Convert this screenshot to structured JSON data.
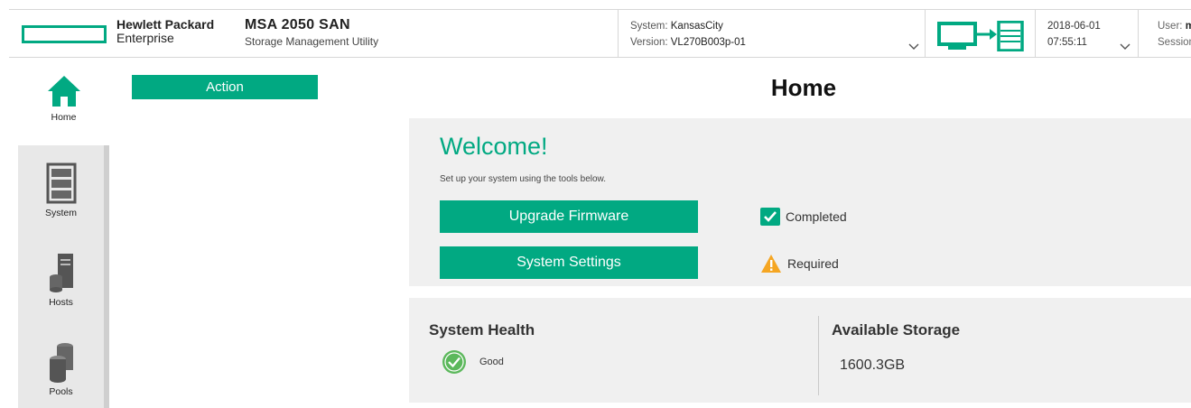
{
  "header": {
    "brand_line1": "Hewlett Packard",
    "brand_line2": "Enterprise",
    "product_name": "MSA 2050 SAN",
    "product_sub": "Storage Management Utility",
    "system_label": "System:",
    "system_value": "KansasCity",
    "version_label": "Version:",
    "version_value": "VL270B003p-01",
    "date": "2018-06-01",
    "time": "07:55:11",
    "user_label": "User:",
    "user_value": "m",
    "session_label": "Session"
  },
  "sidebar": {
    "items": [
      {
        "label": "Home",
        "icon": "home-icon"
      },
      {
        "label": "System",
        "icon": "system-icon"
      },
      {
        "label": "Hosts",
        "icon": "hosts-icon"
      },
      {
        "label": "Pools",
        "icon": "pools-icon"
      }
    ]
  },
  "action_label": "Action",
  "page_title": "Home",
  "welcome": {
    "title": "Welcome!",
    "subtitle": "Set up your system using the tools below.",
    "upgrade_label": "Upgrade Firmware",
    "upgrade_status": "Completed",
    "settings_label": "System Settings",
    "settings_status": "Required"
  },
  "health": {
    "title": "System Health",
    "status": "Good"
  },
  "storage": {
    "title": "Available Storage",
    "value": "1600.3GB"
  },
  "colors": {
    "accent": "#01a982",
    "warning": "#f5a623",
    "health_ok": "#5cb85c"
  }
}
